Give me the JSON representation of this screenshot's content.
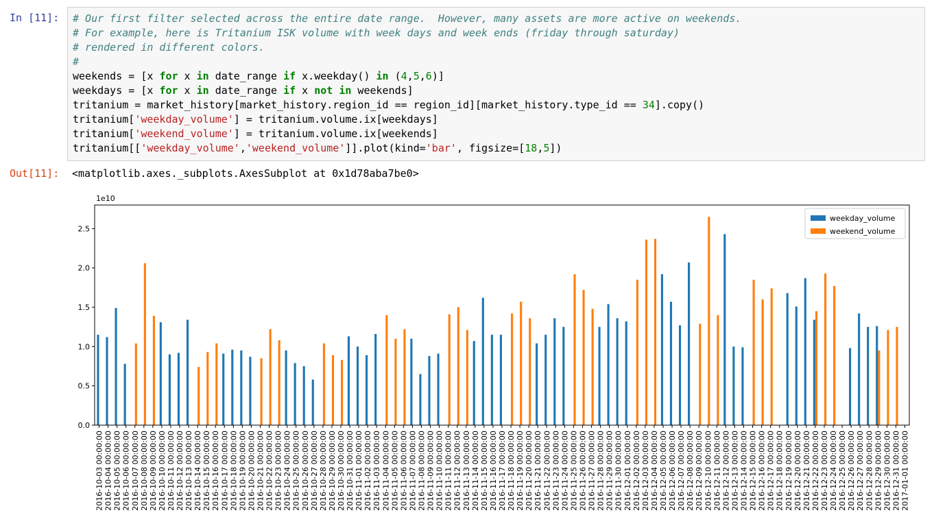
{
  "cell": {
    "in_prompt": "In [11]:",
    "out_prompt": "Out[11]:",
    "output_text": "<matplotlib.axes._subplots.AxesSubplot at 0x1d78aba7be0>"
  },
  "chart_data": {
    "type": "bar",
    "title": "",
    "xlabel": "",
    "ylabel": "",
    "y_offset_label": "1e10",
    "ylim": [
      0,
      2.8
    ],
    "yticks": [
      "0.0",
      "0.5",
      "1.0",
      "1.5",
      "2.0",
      "2.5"
    ],
    "grid": false,
    "legend_position": "top-right",
    "categories": [
      "2016-10-03 00:00:00",
      "2016-10-04 00:00:00",
      "2016-10-05 00:00:00",
      "2016-10-06 00:00:00",
      "2016-10-07 00:00:00",
      "2016-10-08 00:00:00",
      "2016-10-09 00:00:00",
      "2016-10-10 00:00:00",
      "2016-10-11 00:00:00",
      "2016-10-12 00:00:00",
      "2016-10-13 00:00:00",
      "2016-10-14 00:00:00",
      "2016-10-15 00:00:00",
      "2016-10-16 00:00:00",
      "2016-10-17 00:00:00",
      "2016-10-18 00:00:00",
      "2016-10-19 00:00:00",
      "2016-10-20 00:00:00",
      "2016-10-21 00:00:00",
      "2016-10-22 00:00:00",
      "2016-10-23 00:00:00",
      "2016-10-24 00:00:00",
      "2016-10-25 00:00:00",
      "2016-10-26 00:00:00",
      "2016-10-27 00:00:00",
      "2016-10-28 00:00:00",
      "2016-10-29 00:00:00",
      "2016-10-30 00:00:00",
      "2016-10-31 00:00:00",
      "2016-11-01 00:00:00",
      "2016-11-02 00:00:00",
      "2016-11-03 00:00:00",
      "2016-11-04 00:00:00",
      "2016-11-05 00:00:00",
      "2016-11-06 00:00:00",
      "2016-11-07 00:00:00",
      "2016-11-08 00:00:00",
      "2016-11-09 00:00:00",
      "2016-11-10 00:00:00",
      "2016-11-11 00:00:00",
      "2016-11-12 00:00:00",
      "2016-11-13 00:00:00",
      "2016-11-14 00:00:00",
      "2016-11-15 00:00:00",
      "2016-11-16 00:00:00",
      "2016-11-17 00:00:00",
      "2016-11-18 00:00:00",
      "2016-11-19 00:00:00",
      "2016-11-20 00:00:00",
      "2016-11-21 00:00:00",
      "2016-11-22 00:00:00",
      "2016-11-23 00:00:00",
      "2016-11-24 00:00:00",
      "2016-11-25 00:00:00",
      "2016-11-26 00:00:00",
      "2016-11-27 00:00:00",
      "2016-11-28 00:00:00",
      "2016-11-29 00:00:00",
      "2016-11-30 00:00:00",
      "2016-12-01 00:00:00",
      "2016-12-02 00:00:00",
      "2016-12-03 00:00:00",
      "2016-12-04 00:00:00",
      "2016-12-05 00:00:00",
      "2016-12-06 00:00:00",
      "2016-12-07 00:00:00",
      "2016-12-08 00:00:00",
      "2016-12-09 00:00:00",
      "2016-12-10 00:00:00",
      "2016-12-11 00:00:00",
      "2016-12-12 00:00:00",
      "2016-12-13 00:00:00",
      "2016-12-14 00:00:00",
      "2016-12-15 00:00:00",
      "2016-12-16 00:00:00",
      "2016-12-17 00:00:00",
      "2016-12-18 00:00:00",
      "2016-12-19 00:00:00",
      "2016-12-20 00:00:00",
      "2016-12-21 00:00:00",
      "2016-12-22 00:00:00",
      "2016-12-23 00:00:00",
      "2016-12-24 00:00:00",
      "2016-12-25 00:00:00",
      "2016-12-26 00:00:00",
      "2016-12-27 00:00:00",
      "2016-12-28 00:00:00",
      "2016-12-29 00:00:00",
      "2016-12-30 00:00:00",
      "2016-12-31 00:00:00",
      "2017-01-01 00:00:00"
    ],
    "series": [
      {
        "name": "weekday_volume",
        "color": "#1f77b4",
        "values": [
          1.15,
          1.12,
          1.49,
          0.78,
          null,
          null,
          null,
          1.31,
          0.9,
          0.92,
          1.34,
          null,
          null,
          null,
          0.91,
          0.96,
          0.95,
          0.87,
          null,
          null,
          null,
          0.95,
          0.79,
          0.75,
          0.58,
          null,
          null,
          null,
          1.13,
          1.0,
          0.89,
          1.16,
          null,
          null,
          null,
          1.1,
          0.65,
          0.88,
          0.91,
          null,
          null,
          null,
          1.07,
          1.62,
          1.15,
          1.15,
          null,
          null,
          null,
          1.04,
          1.15,
          1.36,
          1.25,
          null,
          null,
          null,
          1.25,
          1.54,
          1.36,
          1.32,
          null,
          null,
          null,
          1.92,
          1.57,
          1.27,
          2.07,
          null,
          null,
          null,
          2.43,
          1.0,
          0.99,
          null,
          null,
          null,
          null,
          1.68,
          1.51,
          1.87,
          1.34,
          null,
          null,
          null,
          0.98,
          1.42,
          1.25,
          1.26,
          null,
          null,
          null
        ]
      },
      {
        "name": "weekend_volume",
        "color": "#ff7f0e",
        "values": [
          null,
          null,
          null,
          null,
          1.04,
          2.06,
          1.39,
          null,
          null,
          null,
          null,
          0.74,
          0.93,
          1.04,
          null,
          null,
          null,
          null,
          0.85,
          1.22,
          1.08,
          null,
          null,
          null,
          null,
          1.04,
          0.89,
          0.83,
          null,
          null,
          null,
          null,
          1.4,
          1.1,
          1.22,
          null,
          null,
          null,
          null,
          1.41,
          1.5,
          1.21,
          null,
          null,
          null,
          null,
          1.42,
          1.57,
          1.36,
          null,
          null,
          null,
          null,
          1.92,
          1.72,
          1.48,
          null,
          null,
          null,
          null,
          1.85,
          2.36,
          2.37,
          null,
          null,
          null,
          null,
          1.29,
          2.65,
          1.4,
          null,
          null,
          null,
          1.85,
          1.6,
          1.74,
          null,
          null,
          null,
          null,
          1.45,
          1.93,
          1.77,
          null,
          null,
          null,
          null,
          0.95,
          1.21,
          1.25
        ]
      }
    ]
  }
}
